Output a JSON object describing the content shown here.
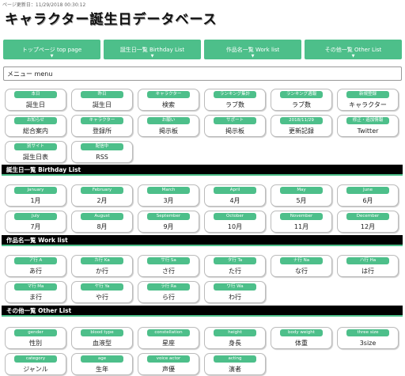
{
  "page": {
    "updated": "ページ更新日：11/29/2018 00:30:12",
    "title": "キャラクター誕生日データベース"
  },
  "topnav": [
    {
      "label": "トップページ top page"
    },
    {
      "label": "誕生日一覧 Birthday List"
    },
    {
      "label": "作品名一覧 Work list"
    },
    {
      "label": "その他一覧 Other List"
    }
  ],
  "menu_label": "メニュー menu",
  "menu_buttons": [
    {
      "tag": "本日",
      "value": "誕生日"
    },
    {
      "tag": "昨日",
      "value": "誕生日"
    },
    {
      "tag": "キャラクター",
      "value": "検索"
    },
    {
      "tag": "ランキング集計",
      "value": "ラブ数"
    },
    {
      "tag": "ランキング週報",
      "value": "ラブ数"
    },
    {
      "tag": "新規登録",
      "value": "キャラクター"
    },
    {
      "tag": "お知らせ",
      "value": "総合案内"
    },
    {
      "tag": "キャラクター",
      "value": "登録所"
    },
    {
      "tag": "お願い",
      "value": "掲示板"
    },
    {
      "tag": "サポート",
      "value": "掲示板"
    },
    {
      "tag": "2018/11/29",
      "value": "更新記録"
    },
    {
      "tag": "修正・追加情報",
      "value": "Twitter"
    },
    {
      "tag": "別サイト",
      "value": "誕生日表"
    },
    {
      "tag": "配信中",
      "value": "RSS"
    }
  ],
  "birthday_heading": "誕生日一覧 Birthday List",
  "months": [
    {
      "tag": "January",
      "value": "1月"
    },
    {
      "tag": "February",
      "value": "2月"
    },
    {
      "tag": "March",
      "value": "3月"
    },
    {
      "tag": "April",
      "value": "4月"
    },
    {
      "tag": "May",
      "value": "5月"
    },
    {
      "tag": "June",
      "value": "6月"
    },
    {
      "tag": "July",
      "value": "7月"
    },
    {
      "tag": "August",
      "value": "8月"
    },
    {
      "tag": "September",
      "value": "9月"
    },
    {
      "tag": "October",
      "value": "10月"
    },
    {
      "tag": "November",
      "value": "11月"
    },
    {
      "tag": "December",
      "value": "12月"
    }
  ],
  "work_heading": "作品名一覧 Work list",
  "kana": [
    {
      "tag": "ア行 A",
      "value": "あ行"
    },
    {
      "tag": "カ行 Ka",
      "value": "か行"
    },
    {
      "tag": "サ行 Sa",
      "value": "さ行"
    },
    {
      "tag": "タ行 Ta",
      "value": "た行"
    },
    {
      "tag": "ナ行 Na",
      "value": "な行"
    },
    {
      "tag": "ハ行 Ha",
      "value": "は行"
    },
    {
      "tag": "マ行 Ma",
      "value": "ま行"
    },
    {
      "tag": "ヤ行 Ya",
      "value": "や行"
    },
    {
      "tag": "ラ行 Ra",
      "value": "ら行"
    },
    {
      "tag": "ワ行 Wa",
      "value": "わ行"
    }
  ],
  "other_heading": "その他一覧 Other List",
  "other": [
    {
      "tag": "gender",
      "value": "性別"
    },
    {
      "tag": "blood type",
      "value": "血液型"
    },
    {
      "tag": "constellation",
      "value": "星座"
    },
    {
      "tag": "height",
      "value": "身長"
    },
    {
      "tag": "body weight",
      "value": "体重"
    },
    {
      "tag": "three size",
      "value": "3size"
    },
    {
      "tag": "category",
      "value": "ジャンル"
    },
    {
      "tag": "age",
      "value": "生年"
    },
    {
      "tag": "voice actor",
      "value": "声優"
    },
    {
      "tag": "acting",
      "value": "演者"
    }
  ],
  "colors": {
    "accent": "#4dbf8a",
    "section_bg": "#000000"
  }
}
